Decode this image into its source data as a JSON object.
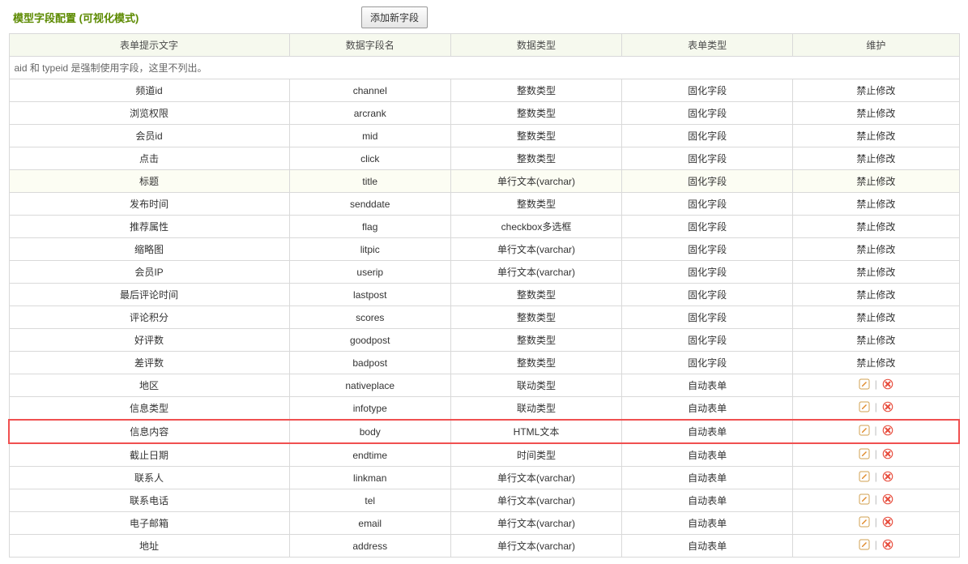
{
  "title": "模型字段配置 (可视化模式)",
  "add_button": "添加新字段",
  "columns": [
    "表单提示文字",
    "数据字段名",
    "数据类型",
    "表单类型",
    "维护"
  ],
  "note_row": "aid 和 typeid 是强制使用字段，这里不列出。",
  "labels": {
    "no_modify": "禁止修改",
    "fixed_field": "固化字段",
    "auto_form": "自动表单",
    "sep": "|"
  },
  "icons": {
    "edit": "edit-icon",
    "delete": "delete-icon"
  },
  "rows": [
    {
      "label": "频道id",
      "field": "channel",
      "dtype": "整数类型",
      "ftype": "fixed",
      "hl": false,
      "box": false
    },
    {
      "label": "浏览权限",
      "field": "arcrank",
      "dtype": "整数类型",
      "ftype": "fixed",
      "hl": false,
      "box": false
    },
    {
      "label": "会员id",
      "field": "mid",
      "dtype": "整数类型",
      "ftype": "fixed",
      "hl": false,
      "box": false
    },
    {
      "label": "点击",
      "field": "click",
      "dtype": "整数类型",
      "ftype": "fixed",
      "hl": false,
      "box": false
    },
    {
      "label": "标题",
      "field": "title",
      "dtype": "单行文本(varchar)",
      "ftype": "fixed",
      "hl": true,
      "box": false
    },
    {
      "label": "发布时间",
      "field": "senddate",
      "dtype": "整数类型",
      "ftype": "fixed",
      "hl": false,
      "box": false
    },
    {
      "label": "推荐属性",
      "field": "flag",
      "dtype": "checkbox多选框",
      "ftype": "fixed",
      "hl": false,
      "box": false
    },
    {
      "label": "缩略图",
      "field": "litpic",
      "dtype": "单行文本(varchar)",
      "ftype": "fixed",
      "hl": false,
      "box": false
    },
    {
      "label": "会员IP",
      "field": "userip",
      "dtype": "单行文本(varchar)",
      "ftype": "fixed",
      "hl": false,
      "box": false
    },
    {
      "label": "最后评论时间",
      "field": "lastpost",
      "dtype": "整数类型",
      "ftype": "fixed",
      "hl": false,
      "box": false
    },
    {
      "label": "评论积分",
      "field": "scores",
      "dtype": "整数类型",
      "ftype": "fixed",
      "hl": false,
      "box": false
    },
    {
      "label": "好评数",
      "field": "goodpost",
      "dtype": "整数类型",
      "ftype": "fixed",
      "hl": false,
      "box": false
    },
    {
      "label": "差评数",
      "field": "badpost",
      "dtype": "整数类型",
      "ftype": "fixed",
      "hl": false,
      "box": false
    },
    {
      "label": "地区",
      "field": "nativeplace",
      "dtype": "联动类型",
      "ftype": "auto",
      "hl": false,
      "box": false
    },
    {
      "label": "信息类型",
      "field": "infotype",
      "dtype": "联动类型",
      "ftype": "auto",
      "hl": false,
      "box": false
    },
    {
      "label": "信息内容",
      "field": "body",
      "dtype": "HTML文本",
      "ftype": "auto",
      "hl": false,
      "box": true
    },
    {
      "label": "截止日期",
      "field": "endtime",
      "dtype": "时间类型",
      "ftype": "auto",
      "hl": false,
      "box": false
    },
    {
      "label": "联系人",
      "field": "linkman",
      "dtype": "单行文本(varchar)",
      "ftype": "auto",
      "hl": false,
      "box": false
    },
    {
      "label": "联系电话",
      "field": "tel",
      "dtype": "单行文本(varchar)",
      "ftype": "auto",
      "hl": false,
      "box": false
    },
    {
      "label": "电子邮箱",
      "field": "email",
      "dtype": "单行文本(varchar)",
      "ftype": "auto",
      "hl": false,
      "box": false
    },
    {
      "label": "地址",
      "field": "address",
      "dtype": "单行文本(varchar)",
      "ftype": "auto",
      "hl": false,
      "box": false
    }
  ]
}
